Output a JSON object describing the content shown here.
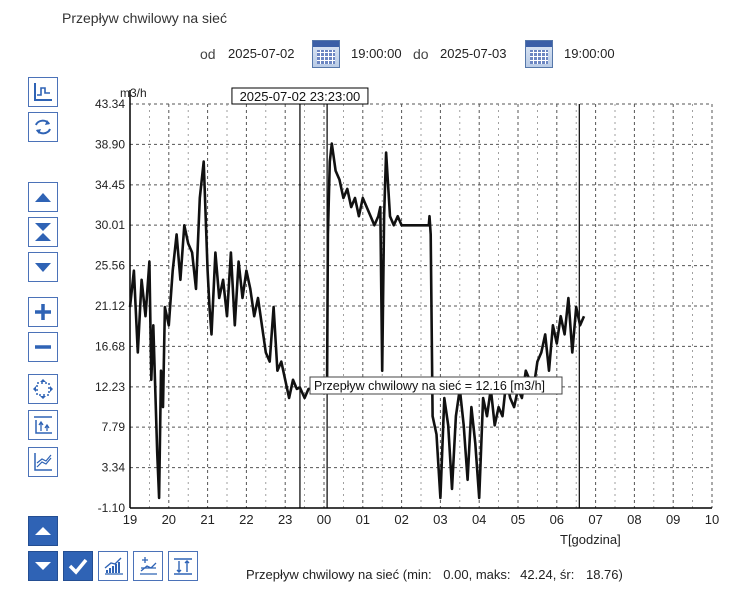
{
  "header": {
    "title": "Przepływ chwilowy na sieć",
    "from_label": "od",
    "from_date": "2025-07-02",
    "from_time": "19:00:00",
    "to_label": "do",
    "to_date": "2025-07-03",
    "to_time": "19:00:00"
  },
  "toolbar_icons": [
    "step-chart-icon",
    "refresh-icon",
    "arrow-up-icon",
    "expand-vertical-icon",
    "arrow-down-icon",
    "zoom-in-icon",
    "zoom-out-icon",
    "fit-to-screen-icon",
    "axis-min-icon",
    "scale-chart-icon"
  ],
  "bottom_icons": [
    "scroll-up-icon",
    "scroll-down-icon",
    "checkmark-icon",
    "trend-icon",
    "plus-minus-chart-icon",
    "axis-limits-icon"
  ],
  "colors": {
    "accent": "#2f63b5",
    "line": "#111111",
    "grid": "#555555"
  },
  "summary": {
    "label": "Przepływ chwilowy na sieć (min:",
    "min": "0.00",
    "max_label": ", maks:",
    "max": "42.24",
    "avg_label": ", śr:",
    "avg": "18.76",
    "close": ")"
  },
  "chart_data": {
    "type": "line",
    "ylabel": "m3/h",
    "xlabel": "T[godzina]",
    "ylim": [
      -1.1,
      43.34
    ],
    "yticks": [
      "43.34",
      "38.90",
      "34.45",
      "30.01",
      "25.56",
      "21.12",
      "16.68",
      "12.23",
      "7.79",
      "3.34",
      "-1.10"
    ],
    "xlim": [
      19,
      34
    ],
    "xticks": [
      {
        "v": 19,
        "label": "19"
      },
      {
        "v": 20,
        "label": "20"
      },
      {
        "v": 21,
        "label": "21"
      },
      {
        "v": 22,
        "label": "22"
      },
      {
        "v": 23,
        "label": "23"
      },
      {
        "v": 24,
        "label": "00"
      },
      {
        "v": 25,
        "label": "01"
      },
      {
        "v": 26,
        "label": "02"
      },
      {
        "v": 27,
        "label": "03"
      },
      {
        "v": 28,
        "label": "04"
      },
      {
        "v": 29,
        "label": "05"
      },
      {
        "v": 30,
        "label": "06"
      },
      {
        "v": 31,
        "label": "07"
      },
      {
        "v": 32,
        "label": "08"
      },
      {
        "v": 33,
        "label": "09"
      },
      {
        "v": 34,
        "label": "10"
      }
    ],
    "grid": true,
    "cursor": {
      "x": 23.38,
      "label": "2025-07-02 23:23:00"
    },
    "markers": [
      24.08,
      30.58
    ],
    "tooltip": "Przepływ chwilowy na sieć = 12.16 [m3/h]",
    "series": [
      {
        "x": [
          19.0,
          19.1,
          19.2,
          19.3,
          19.4,
          19.5,
          19.55,
          19.6,
          19.7,
          19.75,
          19.8,
          19.85,
          19.9,
          20.0,
          20.1,
          20.2,
          20.3,
          20.4,
          20.5,
          20.6,
          20.7,
          20.8,
          20.9,
          21.0,
          21.05,
          21.1,
          21.2,
          21.3,
          21.4,
          21.5,
          21.6,
          21.7,
          21.8,
          21.9,
          22.0,
          22.1,
          22.2,
          22.3,
          22.4,
          22.5,
          22.6,
          22.7,
          22.8,
          22.9,
          23.0,
          23.1,
          23.2,
          23.3,
          23.38,
          23.5,
          23.6,
          23.7,
          23.8,
          23.9,
          24.0,
          24.05,
          24.08,
          24.1,
          24.15,
          24.2,
          24.3,
          24.4,
          24.5,
          24.6,
          24.7,
          24.8,
          24.9,
          25.0,
          25.1,
          25.2,
          25.3,
          25.4,
          25.45,
          25.5,
          25.55,
          25.6,
          25.7,
          25.8,
          25.9,
          26.0,
          26.2,
          26.4,
          26.6,
          26.7,
          26.72,
          26.75,
          26.8,
          26.9,
          27.0,
          27.1,
          27.2,
          27.3,
          27.4,
          27.5,
          27.6,
          27.7,
          27.8,
          27.9,
          28.0,
          28.1,
          28.2,
          28.3,
          28.4,
          28.5,
          28.6,
          28.7,
          28.8,
          28.9,
          29.0,
          29.1,
          29.2,
          29.3,
          29.4,
          29.5,
          29.6,
          29.7,
          29.8,
          29.9,
          30.0,
          30.1,
          30.2,
          30.3,
          30.4,
          30.5,
          30.6,
          30.7
        ],
        "y": [
          21,
          25,
          16,
          24,
          20,
          26,
          13,
          19,
          5,
          0,
          14,
          10,
          21,
          19,
          25,
          29,
          24,
          30,
          28,
          27,
          23,
          33,
          37,
          25,
          21,
          18,
          27,
          22,
          24,
          20,
          27,
          19,
          26,
          22,
          25,
          23,
          20,
          22,
          19,
          16,
          15,
          21,
          14,
          15,
          13,
          11,
          13,
          12,
          12.16,
          11,
          12,
          12,
          13,
          12,
          13,
          12,
          13,
          29,
          37,
          39,
          36,
          35,
          33,
          34,
          32,
          33,
          31,
          33,
          32,
          31,
          30,
          31,
          32,
          14,
          31,
          38,
          31,
          30,
          31,
          30,
          30,
          30,
          30,
          30,
          31,
          29,
          9,
          7,
          0,
          11,
          8,
          1,
          9,
          12,
          8,
          2,
          10,
          6,
          0,
          11,
          9,
          12,
          8,
          10,
          9,
          13,
          11,
          10,
          12,
          11,
          14,
          13,
          12,
          15,
          16,
          18,
          14,
          19,
          17,
          20,
          18,
          22,
          16,
          21,
          19,
          20
        ]
      }
    ]
  }
}
